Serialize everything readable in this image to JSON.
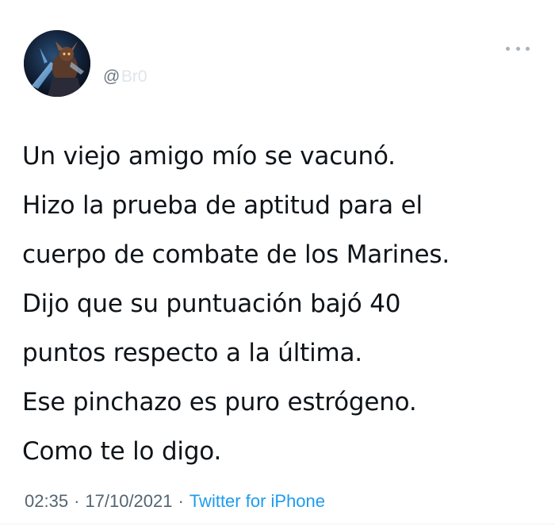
{
  "author": {
    "handle_prefix": "@",
    "handle_name": "Br0"
  },
  "tweet": {
    "lines": [
      "Un viejo amigo mío se vacunó.",
      "Hizo la prueba de aptitud para el",
      "cuerpo de combate de los Marines.",
      "Dijo que su puntuación bajó 40",
      "puntos respecto a la última.",
      "Ese pinchazo es puro estrógeno.",
      "Como te lo digo."
    ]
  },
  "meta": {
    "time": "02:35",
    "separator": "·",
    "date": "17/10/2021",
    "source": "Twitter for iPhone"
  },
  "icons": {
    "more": "more-horizontal-icon",
    "avatar": "avatar-image"
  },
  "colors": {
    "text": "#0f1419",
    "muted": "#536471",
    "link": "#1d9bf0"
  }
}
